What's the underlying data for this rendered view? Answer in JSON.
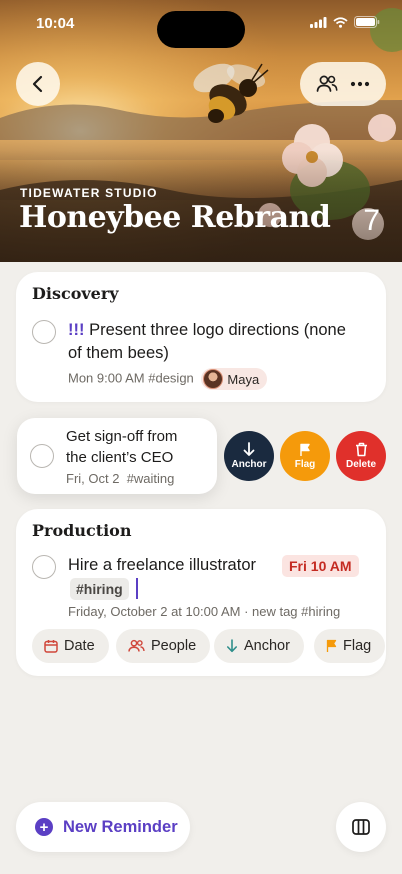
{
  "status": {
    "time": "10:04"
  },
  "project": {
    "studio": "TIDEWATER STUDIO",
    "title": "Honeybee Rebrand",
    "count": "7"
  },
  "discovery": {
    "title": "Discovery",
    "task": {
      "priority": "!!!",
      "title": "Present three logo directions (none of them bees)",
      "line1": "Present three logo directions (none",
      "line2": "of them bees)",
      "when": "Mon 9:00 AM",
      "tag": "#design",
      "person": "Maya"
    }
  },
  "swiped_task": {
    "line1": "Get sign-off from",
    "line2": "the client’s CEO",
    "when": "Fri, Oct 2",
    "tag": "#waiting",
    "actions": {
      "anchor": "Anchor",
      "flag": "Flag",
      "delete": "Delete"
    }
  },
  "production": {
    "title": "Production",
    "task": {
      "title": "Hire a freelance illustrator",
      "time_tag": "Fri 10 AM",
      "hash_tag": "#hiring",
      "hint": "Friday, October 2 at 10:00 AM · new tag #hiring"
    },
    "chips": {
      "date": "Date",
      "people": "People",
      "anchor": "Anchor",
      "flag": "Flag"
    }
  },
  "bottom": {
    "new_reminder": "New Reminder"
  },
  "colors": {
    "accent": "#5b3fc4",
    "anchor": "#1a2a3f",
    "flag": "#f59a0b",
    "delete": "#e0302b",
    "time_tag": "#c42b22"
  }
}
